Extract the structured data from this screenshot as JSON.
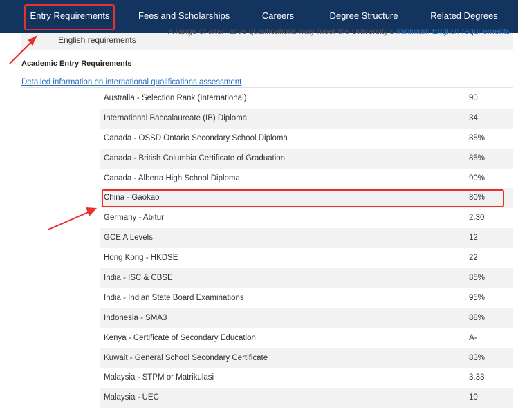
{
  "nav": {
    "tabs": [
      {
        "label": "Entry Requirements"
      },
      {
        "label": "Fees and Scholarships"
      },
      {
        "label": "Careers"
      },
      {
        "label": "Degree Structure"
      },
      {
        "label": "Related Degrees"
      }
    ]
  },
  "english": {
    "label": "English requirements",
    "text": "A range of alternative qualifications may meet the University's",
    "link": "minimum English requirements"
  },
  "academic": {
    "heading": "Academic Entry Requirements",
    "link": "Detailed information on international qualifications assessment",
    "rows": [
      {
        "name": "Australia - Selection Rank (International)",
        "value": "90"
      },
      {
        "name": "International Baccalaureate (IB) Diploma",
        "value": "34"
      },
      {
        "name": "Canada - OSSD Ontario Secondary School Diploma",
        "value": "85%"
      },
      {
        "name": "Canada - British Columbia Certificate of Graduation",
        "value": "85%"
      },
      {
        "name": "Canada - Alberta High School Diploma",
        "value": "90%"
      },
      {
        "name": "China - Gaokao",
        "value": "80%"
      },
      {
        "name": "Germany - Abitur",
        "value": "2.30"
      },
      {
        "name": "GCE A Levels",
        "value": "12"
      },
      {
        "name": "Hong Kong - HKDSE",
        "value": "22"
      },
      {
        "name": "India - ISC & CBSE",
        "value": "85%"
      },
      {
        "name": "India - Indian State Board Examinations",
        "value": "95%"
      },
      {
        "name": "Indonesia - SMA3",
        "value": "88%"
      },
      {
        "name": "Kenya - Certificate of Secondary Education",
        "value": "A-"
      },
      {
        "name": "Kuwait - General School Secondary Certificate",
        "value": "83%"
      },
      {
        "name": "Malaysia - STPM or Matrikulasi",
        "value": "3.33"
      },
      {
        "name": "Malaysia - UEC",
        "value": "10"
      }
    ]
  },
  "colors": {
    "nav_bg": "#12345e",
    "annotation": "#e8312a",
    "link": "#2a6eb8",
    "stripe": "#f2f2f2"
  }
}
